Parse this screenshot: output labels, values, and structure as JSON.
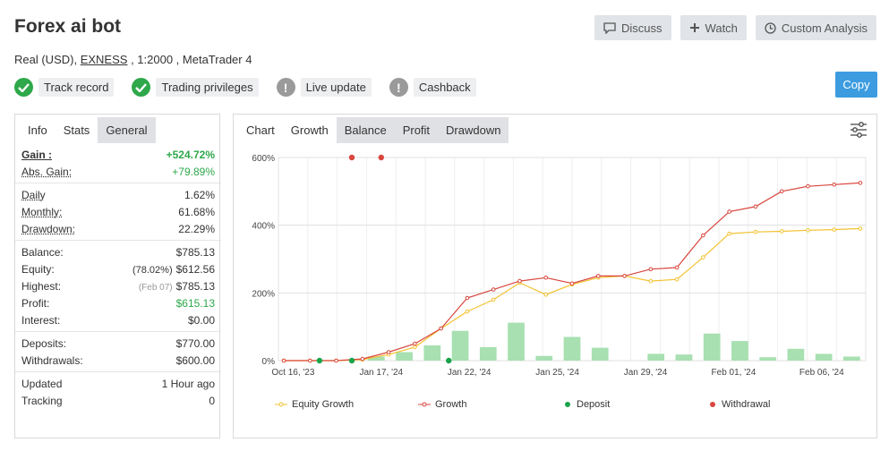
{
  "header": {
    "title": "Forex ai bot",
    "account_type": "Real (USD),",
    "broker": "EXNESS",
    "leverage_platform": ", 1:2000 , MetaTrader 4"
  },
  "actions": {
    "discuss": "Discuss",
    "watch": "Watch",
    "custom_analysis": "Custom Analysis",
    "copy": "Copy"
  },
  "badges": [
    {
      "label": "Track record",
      "status": "ok"
    },
    {
      "label": "Trading privileges",
      "status": "ok"
    },
    {
      "label": "Live update",
      "status": "warn"
    },
    {
      "label": "Cashback",
      "status": "warn"
    }
  ],
  "left_tabs": [
    "Info",
    "Stats",
    "General"
  ],
  "stats": {
    "gain": {
      "label": "Gain :",
      "value": "+524.72%"
    },
    "abs_gain": {
      "label": "Abs. Gain:",
      "value": "+79.89%"
    },
    "daily": {
      "label": "Daily",
      "value": "1.62%"
    },
    "monthly": {
      "label": "Monthly:",
      "value": "61.68%"
    },
    "drawdown": {
      "label": "Drawdown:",
      "value": "22.29%"
    },
    "balance": {
      "label": "Balance:",
      "value": "$785.13"
    },
    "equity": {
      "label": "Equity:",
      "sub": "(78.02%)",
      "value": "$612.56"
    },
    "highest": {
      "label": "Highest:",
      "sub": "(Feb 07)",
      "value": "$785.13"
    },
    "profit": {
      "label": "Profit:",
      "value": "$615.13"
    },
    "interest": {
      "label": "Interest:",
      "value": "$0.00"
    },
    "deposits": {
      "label": "Deposits:",
      "value": "$770.00"
    },
    "withdrawals": {
      "label": "Withdrawals:",
      "value": "$600.00"
    },
    "updated": {
      "label": "Updated",
      "value": "1 Hour ago"
    },
    "tracking": {
      "label": "Tracking",
      "value": "0"
    }
  },
  "chart_tabs": [
    "Chart",
    "Growth",
    "Balance",
    "Profit",
    "Drawdown"
  ],
  "colors": {
    "equity": "#f2c230",
    "growth": "#d9463e",
    "deposit": "#19a34a",
    "withdrawal": "#d9463e",
    "bars": "#a8e0b1",
    "accent": "#3d9ce0"
  },
  "chart_data": {
    "type": "line",
    "y_ticks": [
      "0%",
      "200%",
      "400%",
      "600%"
    ],
    "ylim": [
      0,
      600
    ],
    "x_ticks": [
      "Oct 16, '23",
      "Jan 17, '24",
      "Jan 22, '24",
      "Jan 25, '24",
      "Jan 29, '24",
      "Feb 01, '24",
      "Feb 06, '24"
    ],
    "series": [
      {
        "name": "Equity Growth",
        "values": [
          0,
          0,
          0,
          3,
          18,
          40,
          95,
          145,
          180,
          230,
          195,
          225,
          245,
          250,
          235,
          240,
          305,
          375,
          380,
          382,
          385,
          387,
          390
        ]
      },
      {
        "name": "Growth",
        "values": [
          0,
          0,
          0,
          5,
          25,
          50,
          95,
          185,
          210,
          235,
          245,
          228,
          250,
          250,
          270,
          275,
          370,
          440,
          455,
          500,
          515,
          520,
          525
        ]
      }
    ],
    "bars": [
      0,
      0,
      0,
      12,
      25,
      45,
      88,
      40,
      112,
      14,
      70,
      38,
      0,
      20,
      18,
      80,
      58,
      10,
      35,
      20,
      12
    ],
    "deposits": [
      0,
      0,
      0
    ],
    "withdrawals": [
      600,
      600
    ],
    "legend": [
      "Equity Growth",
      "Growth",
      "Deposit",
      "Withdrawal"
    ]
  }
}
